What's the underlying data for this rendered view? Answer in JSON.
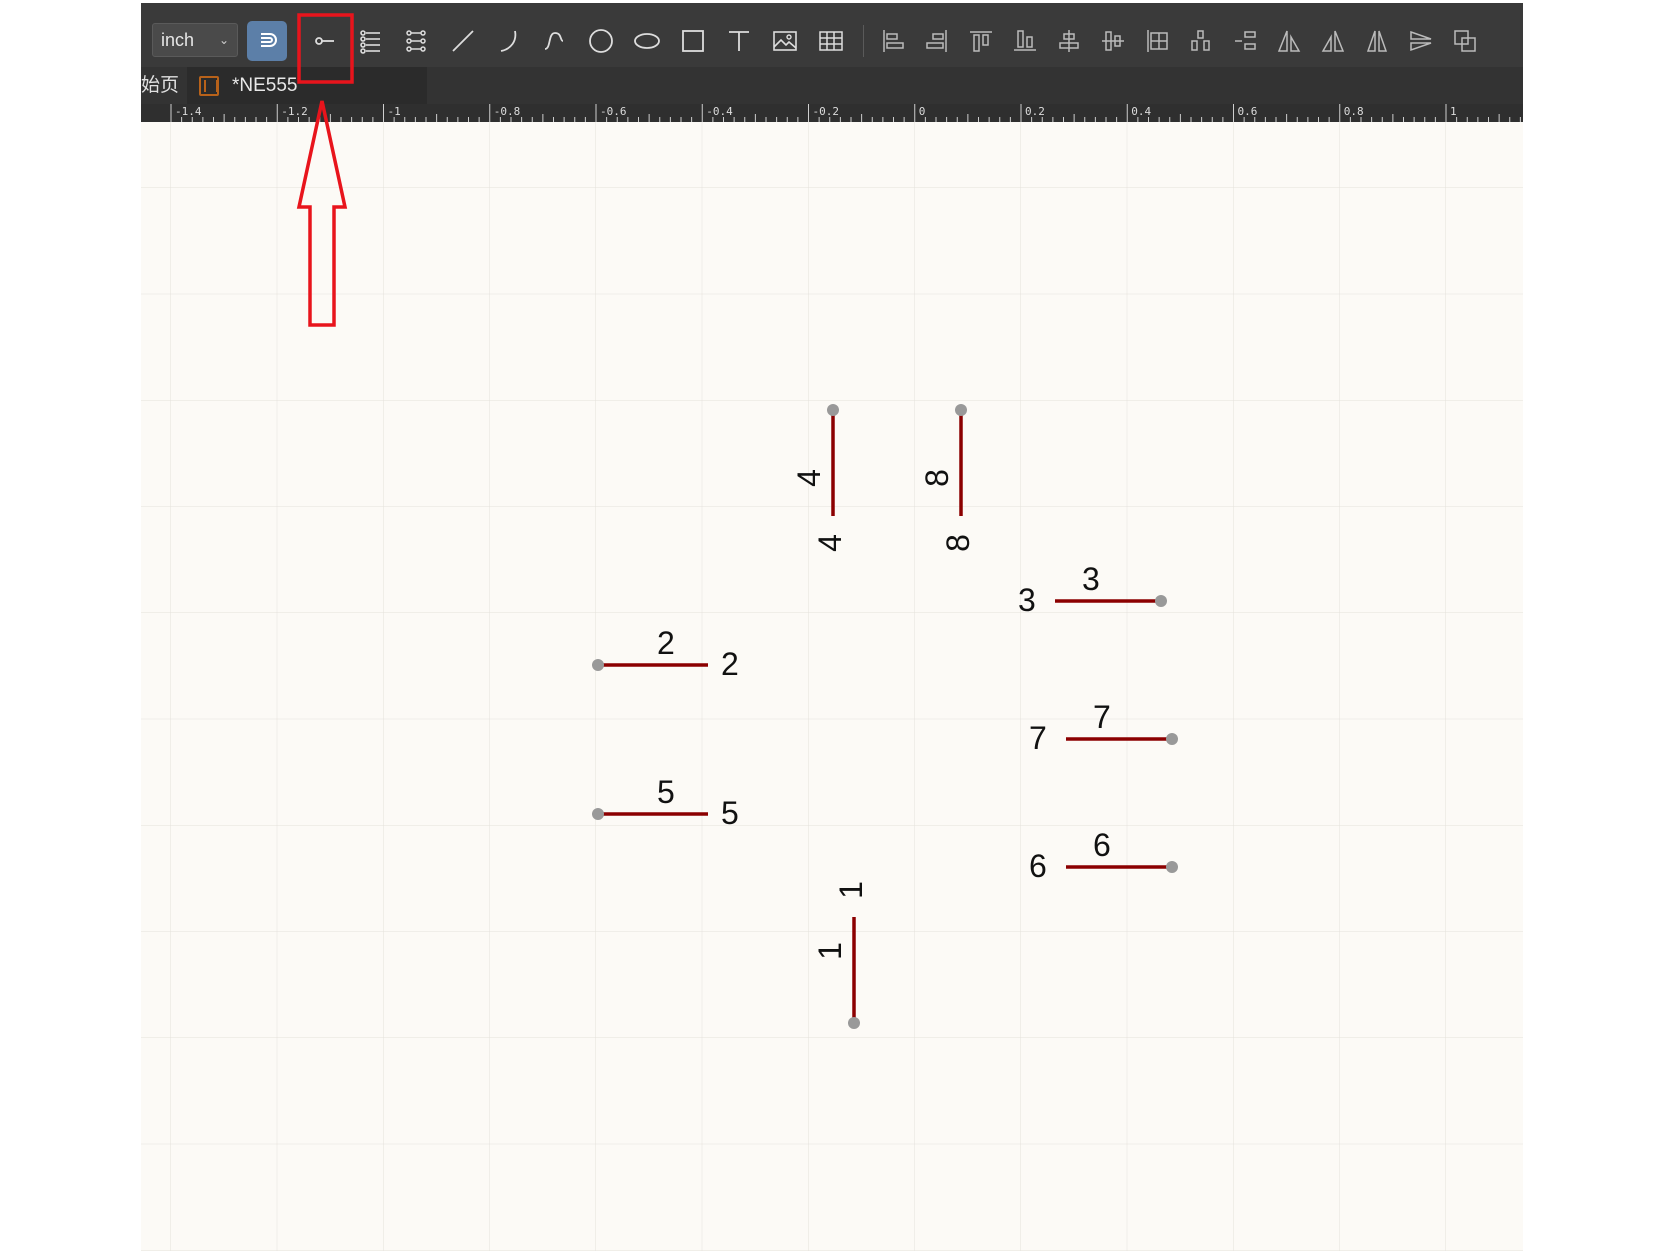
{
  "toolbar": {
    "unit_value": "inch",
    "buttons": [
      {
        "name": "snap-button",
        "icon": "magnet-icon",
        "active": true
      },
      {
        "name": "pin-button",
        "icon": "pin-icon",
        "active": false,
        "highlighted": true
      },
      {
        "name": "pin-array-button",
        "icon": "pin-list-icon"
      },
      {
        "name": "pin-grid-button",
        "icon": "pin-grid-icon"
      },
      {
        "name": "line-button",
        "icon": "line-icon"
      },
      {
        "name": "arc-button",
        "icon": "arc-icon"
      },
      {
        "name": "bezier-button",
        "icon": "bezier-icon"
      },
      {
        "name": "circle-button",
        "icon": "circle-icon"
      },
      {
        "name": "ellipse-button",
        "icon": "ellipse-icon"
      },
      {
        "name": "rectangle-button",
        "icon": "rectangle-icon"
      },
      {
        "name": "text-button",
        "icon": "text-icon"
      },
      {
        "name": "image-button",
        "icon": "image-icon"
      },
      {
        "name": "table-button",
        "icon": "table-icon"
      },
      {
        "name": "align-left-button",
        "icon": "align-left-icon"
      },
      {
        "name": "align-right-button",
        "icon": "align-right-icon"
      },
      {
        "name": "align-top-button",
        "icon": "align-top-icon"
      },
      {
        "name": "align-bottom-button",
        "icon": "align-bottom-icon"
      },
      {
        "name": "align-center-h-button",
        "icon": "align-center-horizontal-icon"
      },
      {
        "name": "align-center-v-button",
        "icon": "align-center-vertical-icon"
      },
      {
        "name": "align-grid-button",
        "icon": "align-grid-icon"
      },
      {
        "name": "distribute-h-button",
        "icon": "distribute-horizontal-icon"
      },
      {
        "name": "distribute-v-button",
        "icon": "distribute-vertical-icon"
      },
      {
        "name": "rotate-left-button",
        "icon": "rotate-left-icon"
      },
      {
        "name": "rotate-right-button",
        "icon": "rotate-right-icon"
      },
      {
        "name": "flip-h-button",
        "icon": "flip-horizontal-icon"
      },
      {
        "name": "flip-v-button",
        "icon": "flip-vertical-icon"
      },
      {
        "name": "arrange-button",
        "icon": "arrange-icon"
      }
    ]
  },
  "tabs": {
    "start_partial": "始页",
    "active_doc": "*NE555"
  },
  "ruler": {
    "labels": [
      "-1.4",
      "-1.2",
      "-1",
      "-0.8",
      "-0.6",
      "-0.4",
      "-0.2",
      "0",
      "0.2",
      "0.4",
      "0.6",
      "0.8",
      "1"
    ]
  },
  "pins": [
    {
      "number": "4",
      "name": "4",
      "orientation": "vertical-up"
    },
    {
      "number": "8",
      "name": "8",
      "orientation": "vertical-up"
    },
    {
      "number": "3",
      "name": "3",
      "orientation": "right"
    },
    {
      "number": "2",
      "name": "2",
      "orientation": "left"
    },
    {
      "number": "7",
      "name": "7",
      "orientation": "right"
    },
    {
      "number": "5",
      "name": "5",
      "orientation": "left"
    },
    {
      "number": "6",
      "name": "6",
      "orientation": "right"
    },
    {
      "number": "1",
      "name": "1",
      "orientation": "vertical-down"
    }
  ],
  "colors": {
    "pin_line": "#8b0000",
    "pin_dot": "#999999",
    "highlight": "#e8141c",
    "grid": "#e4e1db"
  }
}
